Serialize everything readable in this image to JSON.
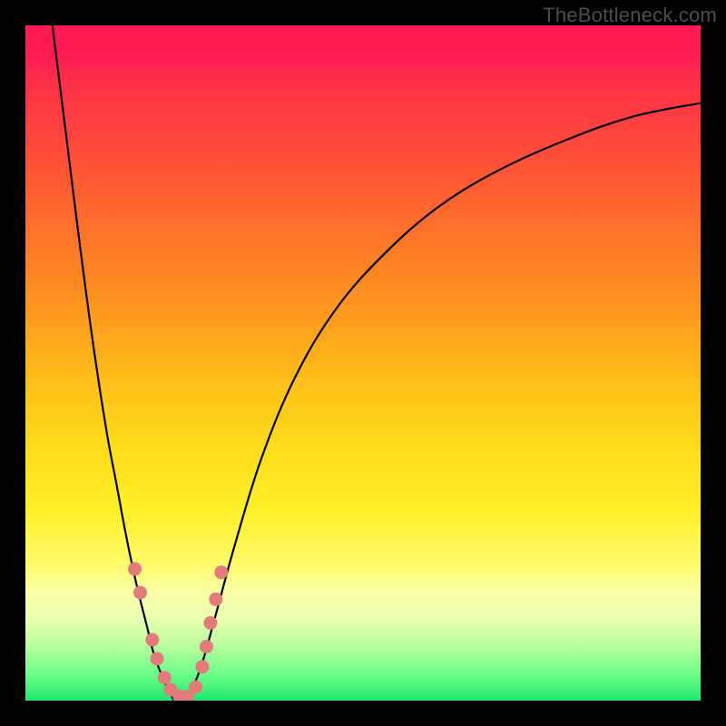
{
  "watermark": "TheBottleneck.com",
  "chart_data": {
    "type": "line",
    "title": "",
    "xlabel": "",
    "ylabel": "",
    "xlim": [
      0,
      100
    ],
    "ylim": [
      0,
      100
    ],
    "series": [
      {
        "name": "left-curve",
        "x": [
          4,
          6,
          8,
          10,
          12,
          13.5,
          15,
          16.5,
          18,
          19,
          20.5,
          22
        ],
        "y": [
          100,
          84,
          68,
          53,
          40,
          32,
          24,
          17,
          11,
          7,
          3,
          0
        ]
      },
      {
        "name": "right-curve",
        "x": [
          24,
          26,
          28,
          31,
          35,
          40,
          46,
          53,
          61,
          70,
          80,
          90,
          100
        ],
        "y": [
          0,
          5,
          12,
          23,
          36,
          48,
          58,
          66,
          73,
          78.5,
          83,
          86.5,
          88.5
        ]
      }
    ],
    "points": {
      "name": "highlight-dots",
      "x": [
        16.2,
        17.0,
        18.8,
        19.5,
        20.6,
        21.5,
        22.8,
        24.0,
        25.2,
        26.2,
        26.8,
        27.4,
        28.2,
        29.0
      ],
      "y": [
        19.5,
        16.0,
        9.0,
        6.2,
        3.4,
        1.6,
        0.6,
        0.6,
        2.0,
        5.0,
        8.0,
        11.5,
        15.0,
        19.0
      ]
    },
    "gradient_colors": {
      "top": "#ff1a54",
      "mid": "#ffdb1a",
      "bottom": "#20e86e"
    },
    "dot_color": "#e37b7b"
  }
}
